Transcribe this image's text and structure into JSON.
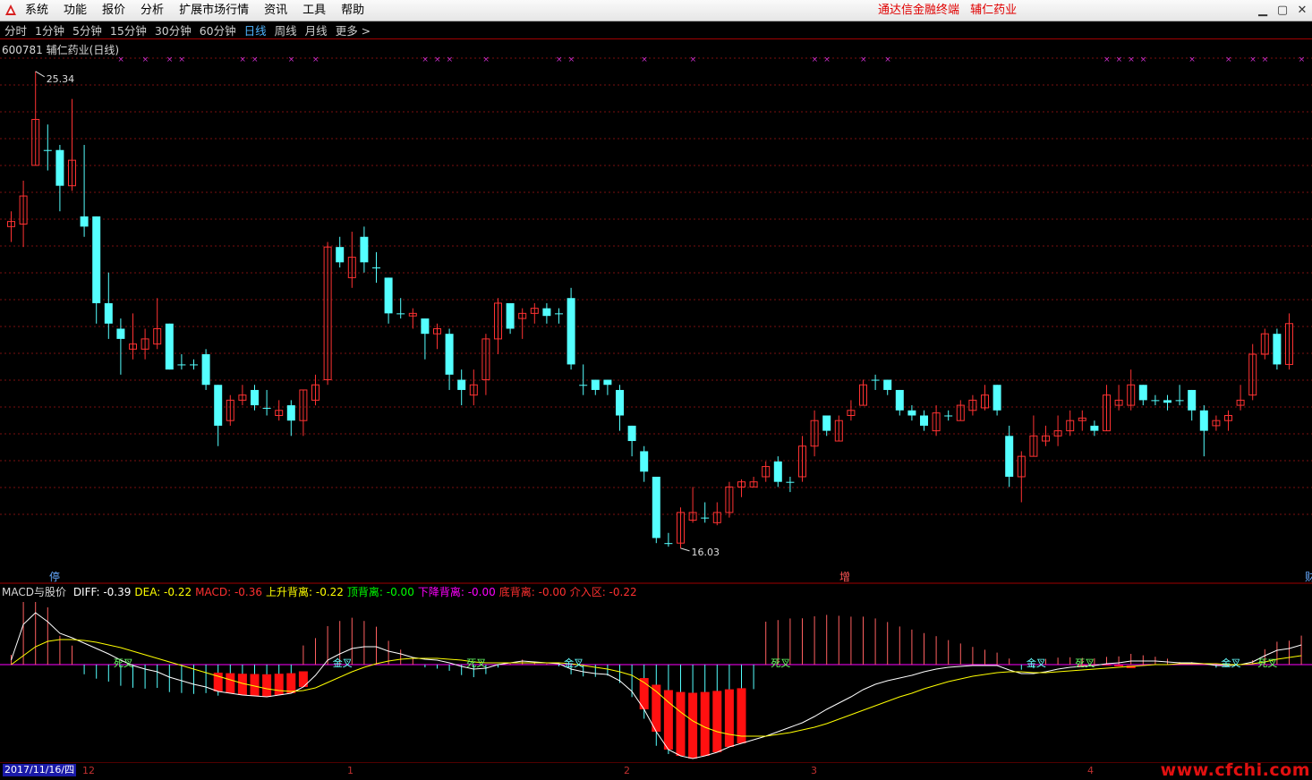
{
  "menu": {
    "items": [
      "系统",
      "功能",
      "报价",
      "分析",
      "扩展市场行情",
      "资讯",
      "工具",
      "帮助"
    ],
    "banner": [
      "通达信金融终端",
      "辅仁药业"
    ]
  },
  "periods": {
    "tabs": [
      "分时",
      "1分钟",
      "5分钟",
      "15分钟",
      "30分钟",
      "60分钟",
      "日线",
      "周线",
      "月线",
      "更多 >"
    ],
    "active": "日线"
  },
  "stock": {
    "code": "600781",
    "name": "辅仁药业(日线)"
  },
  "price_labels": {
    "high": "25.34",
    "low": "16.03"
  },
  "markers": {
    "stop": "停",
    "add": "增",
    "cut": "财"
  },
  "macd_header": {
    "name": "MACD与股价",
    "items": [
      {
        "label": "DIFF:",
        "value": "-0.39",
        "color": "#ffffff"
      },
      {
        "label": "DEA:",
        "value": "-0.22",
        "color": "#ffff00"
      },
      {
        "label": "MACD:",
        "value": "-0.36",
        "color": "#ff3030"
      },
      {
        "label": "上升背离:",
        "value": "-0.22",
        "color": "#ffff00"
      },
      {
        "label": "顶背离:",
        "value": "-0.00",
        "color": "#00ff00"
      },
      {
        "label": "下降背离:",
        "value": "-0.00",
        "color": "#ff00ff"
      },
      {
        "label": "底背离:",
        "value": "-0.00",
        "color": "#ff3030"
      },
      {
        "label": "介入区:",
        "value": "-0.22",
        "color": "#ff3030"
      }
    ]
  },
  "cross_labels": [
    "死叉",
    "金叉",
    "死叉",
    "金叉",
    "死叉",
    "金叉",
    "死叉",
    "金叉",
    "死叉",
    "金叉"
  ],
  "axis": {
    "date": "2017/11/16/四",
    "months": [
      "12",
      "1",
      "2",
      "3",
      "4"
    ]
  },
  "watermark": "www.cfchi.com",
  "colors": {
    "up": "#ff3232",
    "down": "#54ffff",
    "grid": "#7a1010",
    "diff": "#ffffff",
    "dea": "#ffff00",
    "zero": "#ff00ff"
  },
  "chart_data": {
    "type": "candlestick",
    "title": "600781 辅仁药业(日线)",
    "period": "daily",
    "ylim": [
      16.03,
      25.34
    ],
    "high_label": 25.34,
    "low_label": 16.03,
    "candles": [
      {
        "o": 22.3,
        "c": 22.4,
        "h": 22.6,
        "l": 22.0
      },
      {
        "o": 22.35,
        "c": 22.9,
        "h": 23.2,
        "l": 21.9
      },
      {
        "o": 23.5,
        "c": 24.4,
        "h": 25.34,
        "l": 23.5
      },
      {
        "o": 23.8,
        "c": 23.8,
        "h": 24.3,
        "l": 23.4
      },
      {
        "o": 23.8,
        "c": 23.1,
        "h": 23.9,
        "l": 22.6
      },
      {
        "o": 23.1,
        "c": 23.6,
        "h": 24.8,
        "l": 23.0
      },
      {
        "o": 22.5,
        "c": 22.3,
        "h": 23.9,
        "l": 22.1
      },
      {
        "o": 22.5,
        "c": 20.8,
        "h": 22.5,
        "l": 20.4
      },
      {
        "o": 20.8,
        "c": 20.4,
        "h": 21.4,
        "l": 20.1
      },
      {
        "o": 20.3,
        "c": 20.1,
        "h": 20.5,
        "l": 19.4
      },
      {
        "o": 19.9,
        "c": 20.0,
        "h": 20.6,
        "l": 19.7
      },
      {
        "o": 19.9,
        "c": 20.1,
        "h": 20.3,
        "l": 19.7
      },
      {
        "o": 20.0,
        "c": 20.3,
        "h": 20.9,
        "l": 19.9
      },
      {
        "o": 20.4,
        "c": 19.5,
        "h": 20.4,
        "l": 19.5
      },
      {
        "o": 19.6,
        "c": 19.6,
        "h": 19.8,
        "l": 19.5
      },
      {
        "o": 19.6,
        "c": 19.6,
        "h": 19.7,
        "l": 19.5
      },
      {
        "o": 19.8,
        "c": 19.2,
        "h": 19.9,
        "l": 19.1
      },
      {
        "o": 19.2,
        "c": 18.4,
        "h": 19.2,
        "l": 18.0
      },
      {
        "o": 18.5,
        "c": 18.9,
        "h": 19.0,
        "l": 18.4
      },
      {
        "o": 18.9,
        "c": 19.0,
        "h": 19.2,
        "l": 18.8
      },
      {
        "o": 19.1,
        "c": 18.8,
        "h": 19.2,
        "l": 18.7
      },
      {
        "o": 18.75,
        "c": 18.75,
        "h": 19.1,
        "l": 18.6
      },
      {
        "o": 18.6,
        "c": 18.7,
        "h": 18.9,
        "l": 18.5
      },
      {
        "o": 18.8,
        "c": 18.5,
        "h": 18.9,
        "l": 18.2
      },
      {
        "o": 18.5,
        "c": 19.1,
        "h": 19.1,
        "l": 18.2
      },
      {
        "o": 18.9,
        "c": 19.2,
        "h": 19.4,
        "l": 18.8
      },
      {
        "o": 19.3,
        "c": 21.9,
        "h": 22.0,
        "l": 19.2
      },
      {
        "o": 21.9,
        "c": 21.6,
        "h": 22.1,
        "l": 21.5
      },
      {
        "o": 21.3,
        "c": 21.7,
        "h": 22.2,
        "l": 21.1
      },
      {
        "o": 22.1,
        "c": 21.6,
        "h": 22.3,
        "l": 21.4
      },
      {
        "o": 21.5,
        "c": 21.5,
        "h": 21.8,
        "l": 21.2
      },
      {
        "o": 21.3,
        "c": 20.6,
        "h": 21.3,
        "l": 20.4
      },
      {
        "o": 20.6,
        "c": 20.6,
        "h": 20.9,
        "l": 20.5
      },
      {
        "o": 20.55,
        "c": 20.6,
        "h": 20.7,
        "l": 20.3
      },
      {
        "o": 20.5,
        "c": 20.2,
        "h": 20.5,
        "l": 19.7
      },
      {
        "o": 20.2,
        "c": 20.3,
        "h": 20.4,
        "l": 19.9
      },
      {
        "o": 20.2,
        "c": 19.4,
        "h": 20.3,
        "l": 19.1
      },
      {
        "o": 19.3,
        "c": 19.1,
        "h": 19.5,
        "l": 18.8
      },
      {
        "o": 19.0,
        "c": 19.2,
        "h": 19.5,
        "l": 18.8
      },
      {
        "o": 19.3,
        "c": 20.1,
        "h": 20.2,
        "l": 19.0
      },
      {
        "o": 20.1,
        "c": 20.8,
        "h": 20.9,
        "l": 19.8
      },
      {
        "o": 20.8,
        "c": 20.3,
        "h": 20.8,
        "l": 20.2
      },
      {
        "o": 20.5,
        "c": 20.6,
        "h": 20.7,
        "l": 20.1
      },
      {
        "o": 20.6,
        "c": 20.7,
        "h": 20.8,
        "l": 20.4
      },
      {
        "o": 20.7,
        "c": 20.55,
        "h": 20.8,
        "l": 20.4
      },
      {
        "o": 20.6,
        "c": 20.6,
        "h": 20.7,
        "l": 20.4
      },
      {
        "o": 20.9,
        "c": 19.6,
        "h": 21.1,
        "l": 19.5
      },
      {
        "o": 19.2,
        "c": 19.2,
        "h": 19.6,
        "l": 19.0
      },
      {
        "o": 19.3,
        "c": 19.1,
        "h": 19.3,
        "l": 19.0
      },
      {
        "o": 19.3,
        "c": 19.2,
        "h": 19.3,
        "l": 19.0
      },
      {
        "o": 19.1,
        "c": 18.6,
        "h": 19.2,
        "l": 18.3
      },
      {
        "o": 18.4,
        "c": 18.1,
        "h": 18.4,
        "l": 17.8
      },
      {
        "o": 17.9,
        "c": 17.5,
        "h": 18.0,
        "l": 17.3
      },
      {
        "o": 17.4,
        "c": 16.2,
        "h": 17.4,
        "l": 16.1
      },
      {
        "o": 16.1,
        "c": 16.1,
        "h": 16.3,
        "l": 16.03
      },
      {
        "o": 16.1,
        "c": 16.7,
        "h": 16.8,
        "l": 16.0
      },
      {
        "o": 16.55,
        "c": 16.7,
        "h": 17.2,
        "l": 16.5
      },
      {
        "o": 16.6,
        "c": 16.6,
        "h": 16.9,
        "l": 16.5
      },
      {
        "o": 16.5,
        "c": 16.7,
        "h": 16.9,
        "l": 16.45
      },
      {
        "o": 16.7,
        "c": 17.2,
        "h": 17.3,
        "l": 16.6
      },
      {
        "o": 17.2,
        "c": 17.3,
        "h": 17.35,
        "l": 17.0
      },
      {
        "o": 17.2,
        "c": 17.3,
        "h": 17.4,
        "l": 17.2
      },
      {
        "o": 17.4,
        "c": 17.6,
        "h": 17.7,
        "l": 17.3
      },
      {
        "o": 17.7,
        "c": 17.3,
        "h": 17.8,
        "l": 17.2
      },
      {
        "o": 17.3,
        "c": 17.3,
        "h": 17.4,
        "l": 17.1
      },
      {
        "o": 17.4,
        "c": 18.0,
        "h": 18.2,
        "l": 17.3
      },
      {
        "o": 18.0,
        "c": 18.5,
        "h": 18.7,
        "l": 17.8
      },
      {
        "o": 18.6,
        "c": 18.3,
        "h": 18.6,
        "l": 18.2
      },
      {
        "o": 18.1,
        "c": 18.5,
        "h": 18.6,
        "l": 18.1
      },
      {
        "o": 18.6,
        "c": 18.7,
        "h": 18.9,
        "l": 18.5
      },
      {
        "o": 18.8,
        "c": 19.2,
        "h": 19.3,
        "l": 18.8
      },
      {
        "o": 19.3,
        "c": 19.3,
        "h": 19.4,
        "l": 19.1
      },
      {
        "o": 19.3,
        "c": 19.1,
        "h": 19.3,
        "l": 19.0
      },
      {
        "o": 19.1,
        "c": 18.7,
        "h": 19.1,
        "l": 18.6
      },
      {
        "o": 18.7,
        "c": 18.6,
        "h": 18.8,
        "l": 18.5
      },
      {
        "o": 18.6,
        "c": 18.4,
        "h": 18.7,
        "l": 18.3
      },
      {
        "o": 18.3,
        "c": 18.65,
        "h": 18.8,
        "l": 18.2
      },
      {
        "o": 18.6,
        "c": 18.6,
        "h": 18.7,
        "l": 18.5
      },
      {
        "o": 18.5,
        "c": 18.8,
        "h": 18.9,
        "l": 18.5
      },
      {
        "o": 18.7,
        "c": 18.9,
        "h": 19.0,
        "l": 18.6
      },
      {
        "o": 18.75,
        "c": 19.0,
        "h": 19.2,
        "l": 18.7
      },
      {
        "o": 19.2,
        "c": 18.7,
        "h": 19.2,
        "l": 18.6
      },
      {
        "o": 18.2,
        "c": 17.4,
        "h": 18.4,
        "l": 17.2
      },
      {
        "o": 17.4,
        "c": 17.8,
        "h": 17.9,
        "l": 16.9
      },
      {
        "o": 17.8,
        "c": 18.2,
        "h": 18.6,
        "l": 17.8
      },
      {
        "o": 18.1,
        "c": 18.2,
        "h": 18.4,
        "l": 18.0
      },
      {
        "o": 18.2,
        "c": 18.3,
        "h": 18.6,
        "l": 18.0
      },
      {
        "o": 18.3,
        "c": 18.5,
        "h": 18.7,
        "l": 18.2
      },
      {
        "o": 18.5,
        "c": 18.55,
        "h": 18.7,
        "l": 18.3
      },
      {
        "o": 18.4,
        "c": 18.3,
        "h": 18.5,
        "l": 18.2
      },
      {
        "o": 18.3,
        "c": 19.0,
        "h": 19.2,
        "l": 18.3
      },
      {
        "o": 18.8,
        "c": 18.9,
        "h": 19.2,
        "l": 18.7
      },
      {
        "o": 18.8,
        "c": 19.2,
        "h": 19.5,
        "l": 18.7
      },
      {
        "o": 19.2,
        "c": 18.9,
        "h": 19.2,
        "l": 18.8
      },
      {
        "o": 18.9,
        "c": 18.9,
        "h": 19.0,
        "l": 18.8
      },
      {
        "o": 18.9,
        "c": 18.85,
        "h": 19.0,
        "l": 18.7
      },
      {
        "o": 18.9,
        "c": 18.9,
        "h": 19.2,
        "l": 18.8
      },
      {
        "o": 19.1,
        "c": 18.7,
        "h": 19.1,
        "l": 18.5
      },
      {
        "o": 18.7,
        "c": 18.3,
        "h": 18.8,
        "l": 17.8
      },
      {
        "o": 18.4,
        "c": 18.5,
        "h": 18.6,
        "l": 18.3
      },
      {
        "o": 18.5,
        "c": 18.6,
        "h": 18.7,
        "l": 18.3
      },
      {
        "o": 18.8,
        "c": 18.9,
        "h": 19.2,
        "l": 18.7
      },
      {
        "o": 19.0,
        "c": 19.8,
        "h": 20.0,
        "l": 18.9
      },
      {
        "o": 19.8,
        "c": 20.2,
        "h": 20.3,
        "l": 19.7
      },
      {
        "o": 20.2,
        "c": 19.6,
        "h": 20.3,
        "l": 19.5
      },
      {
        "o": 19.6,
        "c": 20.4,
        "h": 20.6,
        "l": 19.5
      }
    ],
    "macd": {
      "diff": [
        0.05,
        0.45,
        0.58,
        0.48,
        0.35,
        0.3,
        0.24,
        0.18,
        0.12,
        0.05,
        -0.01,
        -0.05,
        -0.08,
        -0.14,
        -0.18,
        -0.22,
        -0.25,
        -0.3,
        -0.32,
        -0.34,
        -0.35,
        -0.36,
        -0.34,
        -0.32,
        -0.25,
        -0.12,
        0.05,
        0.12,
        0.18,
        0.2,
        0.2,
        0.15,
        0.12,
        0.08,
        0.06,
        0.05,
        0.02,
        -0.02,
        -0.05,
        -0.04,
        0.0,
        0.02,
        0.04,
        0.03,
        0.02,
        0.01,
        -0.05,
        -0.08,
        -0.1,
        -0.11,
        -0.18,
        -0.3,
        -0.5,
        -0.75,
        -0.95,
        -1.02,
        -1.05,
        -1.02,
        -0.98,
        -0.92,
        -0.88,
        -0.84,
        -0.8,
        -0.75,
        -0.7,
        -0.65,
        -0.58,
        -0.5,
        -0.43,
        -0.36,
        -0.28,
        -0.22,
        -0.18,
        -0.15,
        -0.12,
        -0.08,
        -0.05,
        -0.03,
        -0.02,
        -0.01,
        -0.01,
        -0.01,
        -0.06,
        -0.1,
        -0.1,
        -0.08,
        -0.05,
        -0.03,
        -0.02,
        -0.01,
        0.01,
        0.02,
        0.04,
        0.04,
        0.04,
        0.03,
        0.02,
        0.02,
        0.01,
        -0.01,
        -0.01,
        0.0,
        0.03,
        0.1,
        0.16,
        0.18,
        0.22
      ],
      "dea": [
        0.0,
        0.1,
        0.2,
        0.26,
        0.28,
        0.28,
        0.27,
        0.25,
        0.22,
        0.19,
        0.15,
        0.11,
        0.07,
        0.03,
        -0.01,
        -0.05,
        -0.09,
        -0.13,
        -0.17,
        -0.21,
        -0.24,
        -0.27,
        -0.29,
        -0.3,
        -0.29,
        -0.26,
        -0.2,
        -0.14,
        -0.08,
        -0.03,
        0.01,
        0.04,
        0.06,
        0.07,
        0.07,
        0.07,
        0.06,
        0.05,
        0.03,
        0.02,
        0.02,
        0.02,
        0.02,
        0.02,
        0.02,
        0.02,
        0.01,
        -0.01,
        -0.03,
        -0.05,
        -0.08,
        -0.12,
        -0.2,
        -0.3,
        -0.42,
        -0.53,
        -0.63,
        -0.7,
        -0.75,
        -0.78,
        -0.8,
        -0.8,
        -0.8,
        -0.78,
        -0.76,
        -0.73,
        -0.7,
        -0.66,
        -0.61,
        -0.56,
        -0.51,
        -0.46,
        -0.41,
        -0.36,
        -0.32,
        -0.27,
        -0.23,
        -0.19,
        -0.16,
        -0.13,
        -0.11,
        -0.09,
        -0.08,
        -0.08,
        -0.09,
        -0.09,
        -0.08,
        -0.07,
        -0.06,
        -0.05,
        -0.04,
        -0.03,
        -0.02,
        -0.01,
        0.0,
        0.0,
        0.01,
        0.01,
        0.01,
        0.01,
        0.0,
        0.0,
        0.01,
        0.03,
        0.06,
        0.08,
        0.1
      ]
    }
  }
}
